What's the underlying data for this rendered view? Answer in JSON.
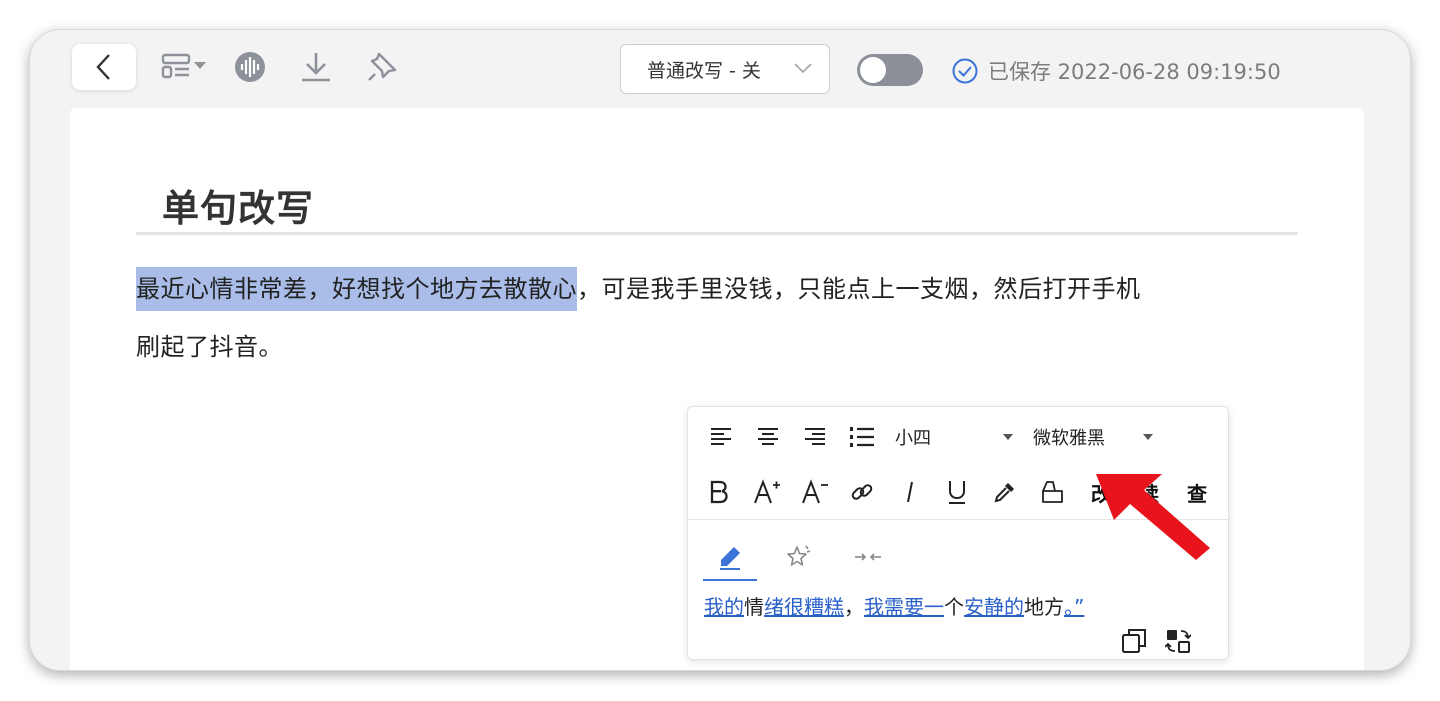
{
  "toolbar": {
    "back_icon": "chevron-left-icon",
    "layout_icon": "layout-dropdown-icon",
    "audio_icon": "audio-wave-icon",
    "download_icon": "download-icon",
    "pin_icon": "pin-icon",
    "mode_select": {
      "value": "普通改写 - 关"
    },
    "toggle": {
      "on": false
    },
    "saved_status": "已保存 2022-06-28 09:19:50"
  },
  "document": {
    "title": "单句改写",
    "paragraph": {
      "highlighted": "最近心情非常差，好想找个地方去散散心",
      "rest_line1": "，可是我手里没钱，只能点上一支烟，然后打开手机",
      "rest_line2": "刷起了抖音。"
    }
  },
  "popup": {
    "row1": {
      "font_size": "小四",
      "font_family": "微软雅黑"
    },
    "row2": {
      "rewrite_label": "改",
      "read_label": "读",
      "check_label": "查"
    },
    "result": {
      "segments": [
        {
          "text": "我的",
          "link": true
        },
        {
          "text": "情",
          "link": false
        },
        {
          "text": "绪很糟糕",
          "link": true
        },
        {
          "text": "，",
          "link": false
        },
        {
          "text": "我需要一",
          "link": true
        },
        {
          "text": "个",
          "link": false
        },
        {
          "text": "安静的",
          "link": true
        },
        {
          "text": "地方",
          "link": false
        },
        {
          "text": "。”",
          "link": true
        }
      ]
    }
  },
  "colors": {
    "highlight": "#a9bde8",
    "link": "#2a61c8",
    "accent": "#3b73d8",
    "annotation_arrow": "#e8131b"
  }
}
